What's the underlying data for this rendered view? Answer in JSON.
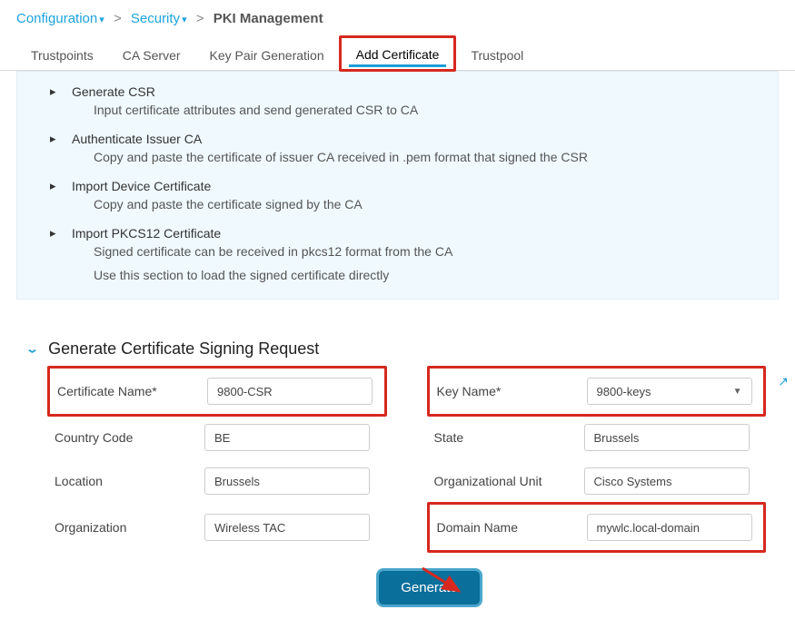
{
  "breadcrumb": {
    "configuration": "Configuration",
    "security": "Security",
    "current": "PKI Management"
  },
  "tabs": {
    "trustpoints": "Trustpoints",
    "ca_server": "CA Server",
    "keypair": "Key Pair Generation",
    "add_cert": "Add Certificate",
    "trustpool": "Trustpool"
  },
  "steps": {
    "s1_title": "Generate CSR",
    "s1_desc": "Input certificate attributes and send generated CSR to CA",
    "s2_title": "Authenticate Issuer CA",
    "s2_desc": "Copy and paste the certificate of issuer CA received in .pem format that signed the CSR",
    "s3_title": "Import Device Certificate",
    "s3_desc": "Copy and paste the certificate signed by the CA",
    "s4_title": "Import PKCS12 Certificate",
    "s4_desc1": "Signed certificate can be received in pkcs12 format from the CA",
    "s4_desc2": "Use this section to load the signed certificate directly"
  },
  "section": {
    "title": "Generate Certificate Signing Request"
  },
  "form": {
    "cert_name_label": "Certificate Name*",
    "cert_name_value": "9800-CSR",
    "key_name_label": "Key Name*",
    "key_name_value": "9800-keys",
    "country_label": "Country Code",
    "country_value": "BE",
    "state_label": "State",
    "state_value": "Brussels",
    "location_label": "Location",
    "location_value": "Brussels",
    "ou_label": "Organizational Unit",
    "ou_value": "Cisco Systems",
    "org_label": "Organization",
    "org_value": "Wireless TAC",
    "domain_label": "Domain Name",
    "domain_value": "mywlc.local-domain"
  },
  "buttons": {
    "generate": "Generate"
  }
}
